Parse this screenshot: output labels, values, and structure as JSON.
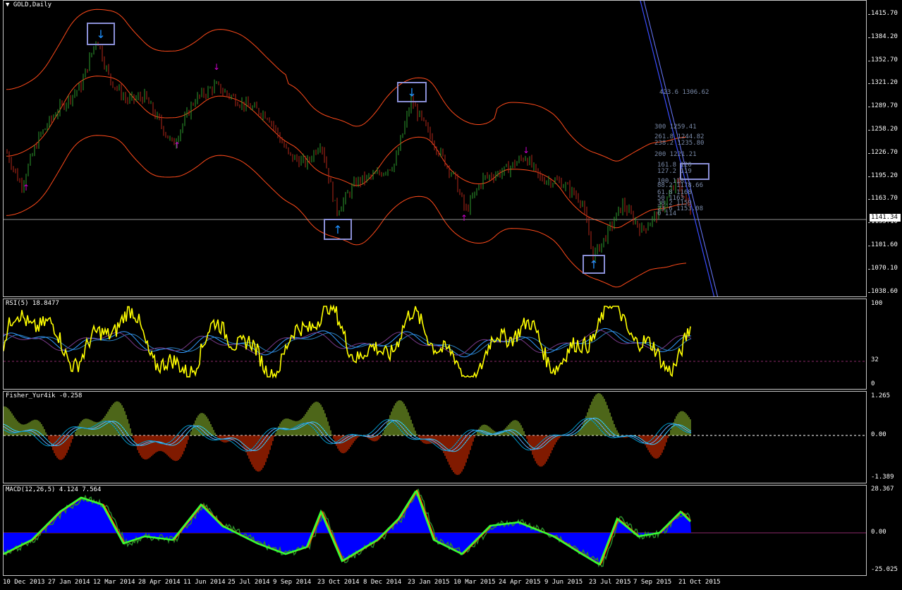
{
  "chart": {
    "title": "GOLD,Daily",
    "current_price": "1141.34"
  },
  "colors": {
    "background": "#000000",
    "bull_candle": "#2e9b2e",
    "bear_candle": "#b3271a",
    "envelope": "#ff4a1a",
    "rsi_line": "#ffff00",
    "fisher_up": "#9acd32",
    "fisher_down": "#ff3300",
    "macd_hist": "#0000ff",
    "signal_up_arrow": "#1e90ff",
    "signal_down_arrow": "#cc00cc",
    "box": "#8a8fd6"
  },
  "price_axis": [
    "1415.70",
    "1384.20",
    "1352.70",
    "1321.20",
    "1289.70",
    "1258.20",
    "1226.70",
    "1195.20",
    "1163.70",
    "1133.10",
    "1101.60",
    "1070.10",
    "1038.60"
  ],
  "fibo_labels": [
    "423.6 1306.62",
    "300 1259.41",
    "261.8 1244.82",
    "238.2 1235.80",
    "200 1221.21",
    "161.8 120",
    "127.2 119",
    "100 118",
    "88.2 1178.66",
    "61.8 1168",
    "50 1163",
    "38.2 1159",
    "23.6 1153.08",
    "0 114"
  ],
  "rsi": {
    "label": "RSI(5) 18.8477",
    "axis": [
      "100",
      "32",
      "0"
    ]
  },
  "fisher": {
    "label": "Fisher_Yur4ik -0.258",
    "axis": [
      "1.265",
      "0.00",
      "-1.389"
    ]
  },
  "macd": {
    "label": "MACD(12,26,5) 4.124 7.564",
    "axis": [
      "28.367",
      "0.00",
      "-25.025"
    ]
  },
  "time_axis": [
    "10 Dec 2013",
    "27 Jan 2014",
    "12 Mar 2014",
    "28 Apr 2014",
    "11 Jun 2014",
    "25 Jul 2014",
    "9 Sep 2014",
    "23 Oct 2014",
    "8 Dec 2014",
    "23 Jan 2015",
    "10 Mar 2015",
    "24 Apr 2015",
    "9 Jun 2015",
    "23 Jul 2015",
    "7 Sep 2015",
    "21 Oct 2015"
  ],
  "chart_data": {
    "type": "line",
    "title": "GOLD,Daily",
    "x": [
      "10 Dec 2013",
      "27 Jan 2014",
      "12 Mar 2014",
      "28 Apr 2014",
      "11 Jun 2014",
      "25 Jul 2014",
      "9 Sep 2014",
      "23 Oct 2014",
      "8 Dec 2014",
      "23 Jan 2015",
      "10 Mar 2015",
      "24 Apr 2015",
      "9 Jun 2015",
      "23 Jul 2015",
      "7 Sep 2015",
      "21 Oct 2015"
    ],
    "series": [
      {
        "values": [
          1240,
          1268,
          1385,
          1300,
          1320,
          1300,
          1230,
          1150,
          1200,
          1300,
          1155,
          1210,
          1180,
          1085,
          1130,
          1170
        ]
      }
    ],
    "ylim": [
      1038.6,
      1430
    ],
    "current": 1141.34
  }
}
